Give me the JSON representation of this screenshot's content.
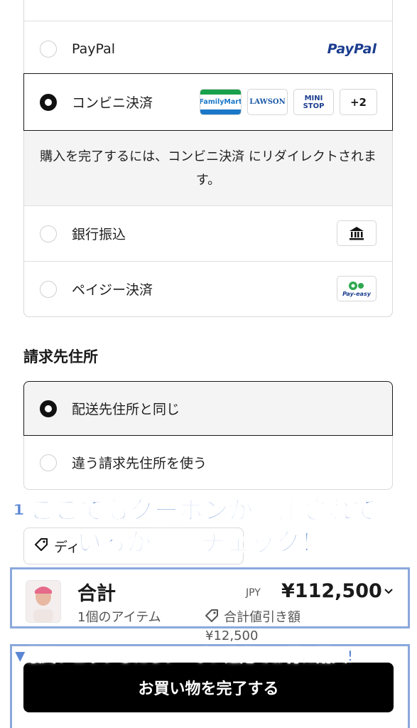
{
  "payment": {
    "paypal": {
      "label": "PayPal",
      "logo": "PayPal"
    },
    "konbini": {
      "label": "コンビニ決済",
      "logos": {
        "familymart": "FamilyMart",
        "lawson": "LAWSON",
        "ministop_top": "MINI",
        "ministop_bottom": "STOP",
        "more": "+2"
      },
      "redirect_note": "購入を完了するには、コンビニ決済 にリダイレクトされます。"
    },
    "bank": {
      "label": "銀行振込",
      "icon": "bank-icon"
    },
    "payeasy": {
      "label": "ペイジー決済",
      "logo": "Pay-easy"
    }
  },
  "billing": {
    "title": "請求先住所",
    "same": "配送先住所と同じ",
    "different": "違う請求先住所を使う"
  },
  "discount": {
    "partial_text": "ディ"
  },
  "summary": {
    "title": "合計",
    "items": "1個のアイテム",
    "currency": "JPY",
    "total": "¥112,500",
    "discount_label": "合計値引き額",
    "discount_value": "¥12,500"
  },
  "complete_button": "お買い物を完了する",
  "annotations": {
    "line1": "①ここでもクーポンが適用されて",
    "line2": "いるか最終チェック！",
    "bottom": "▼最終チェックしたらクーポン適用でお得に購入!"
  },
  "colors": {
    "annotation_blue": "#5b86d4",
    "frame_blue": "#8aa8dc",
    "paypal_dark": "#1b3d8f",
    "paypal_light": "#2a8fd6",
    "familymart_green": "#18a14a",
    "familymart_blue": "#1b78c8"
  }
}
